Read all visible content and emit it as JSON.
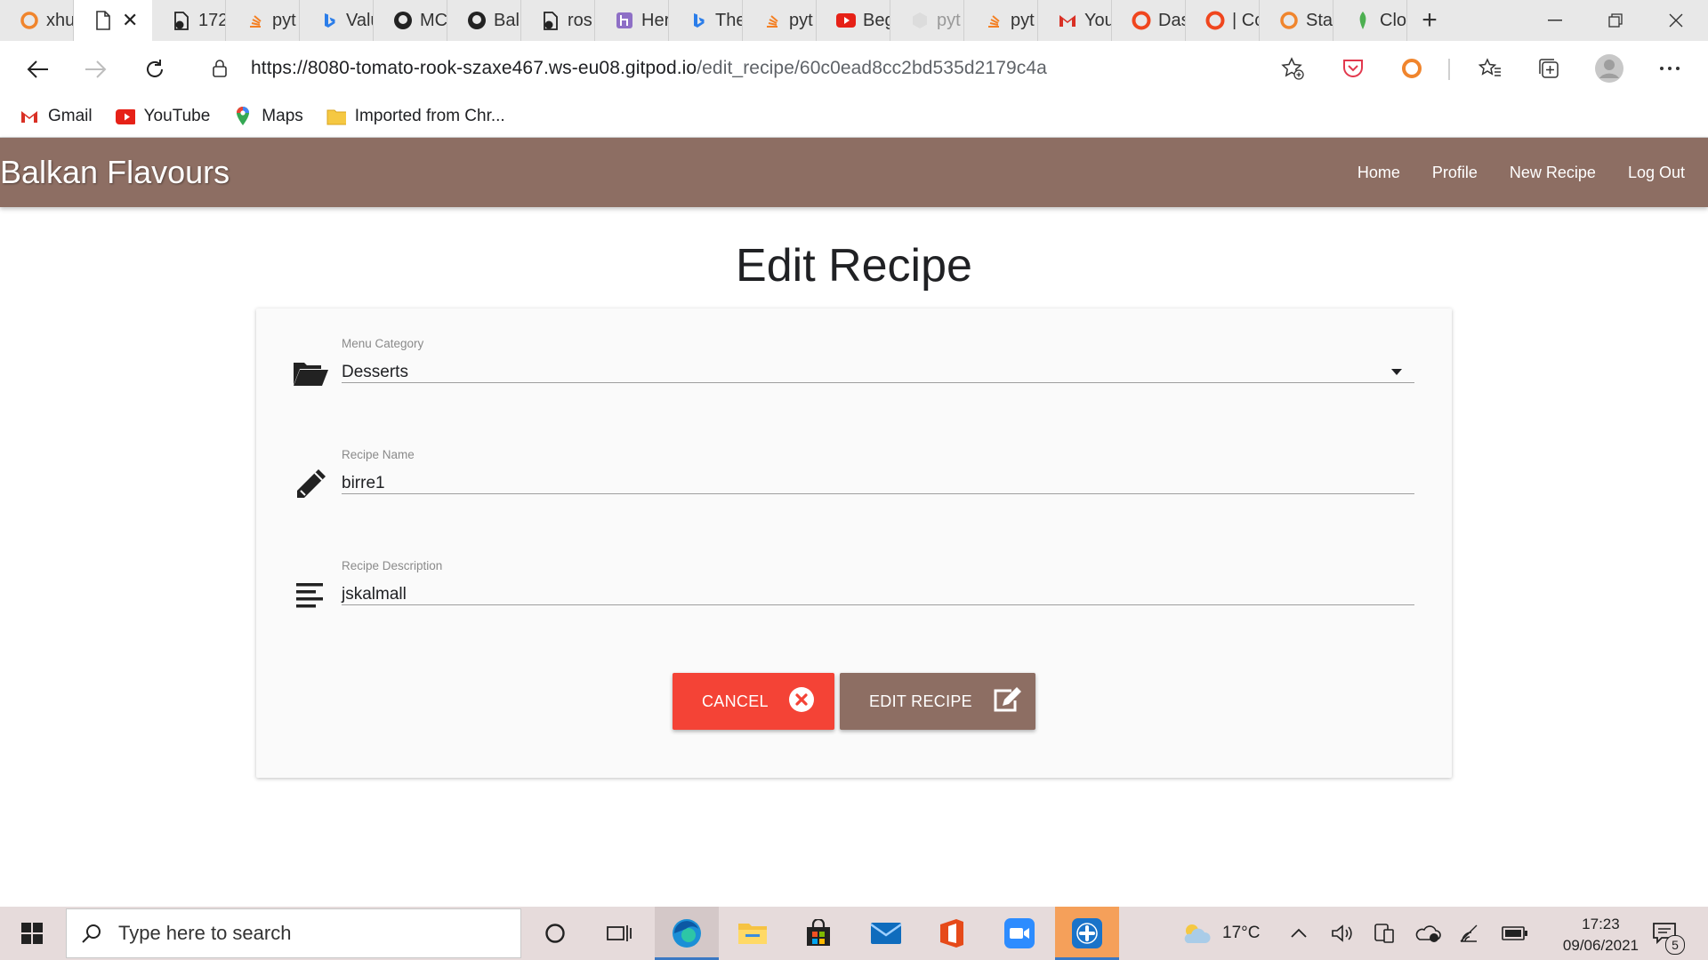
{
  "browser": {
    "tabs": [
      {
        "label": "xhu",
        "icon": "grammarly-icon"
      },
      {
        "label": "",
        "icon": "page-icon",
        "active": true
      },
      {
        "label": "172",
        "icon": "gitpod-icon"
      },
      {
        "label": "pyt",
        "icon": "stackoverflow-icon"
      },
      {
        "label": "Valu",
        "icon": "bing-icon"
      },
      {
        "label": "MC",
        "icon": "github-icon"
      },
      {
        "label": "Ball",
        "icon": "github-icon"
      },
      {
        "label": "ros",
        "icon": "gitpod-icon"
      },
      {
        "label": "Her",
        "icon": "heroku-icon"
      },
      {
        "label": "The",
        "icon": "bing-icon"
      },
      {
        "label": "pyt",
        "icon": "stackoverflow-icon"
      },
      {
        "label": "Beg",
        "icon": "youtube-icon"
      },
      {
        "label": "pyt",
        "icon": "blank-icon"
      },
      {
        "label": "pyt",
        "icon": "stackoverflow-icon"
      },
      {
        "label": "You",
        "icon": "gmail-icon"
      },
      {
        "label": "Das",
        "icon": "opera-icon"
      },
      {
        "label": "| Cc",
        "icon": "opera-icon"
      },
      {
        "label": "Sta",
        "icon": "grammarly-icon"
      },
      {
        "label": "Clo",
        "icon": "mongodb-icon"
      }
    ],
    "url_main": "https://8080-tomato-rook-szaxe467.ws-eu08.gitpod.io",
    "url_path": "/edit_recipe/60c0ead8cc2bd535d2179c4a",
    "bookmarks": [
      {
        "label": "Gmail",
        "icon": "gmail-icon"
      },
      {
        "label": "YouTube",
        "icon": "youtube-icon"
      },
      {
        "label": "Maps",
        "icon": "maps-pin-icon"
      },
      {
        "label": "Imported from Chr...",
        "icon": "folder-icon"
      }
    ]
  },
  "app": {
    "brand": "Balkan Flavours",
    "nav": [
      "Home",
      "Profile",
      "New Recipe",
      "Log Out"
    ],
    "page_title": "Edit Recipe",
    "form": {
      "category_label": "Menu Category",
      "category_value": "Desserts",
      "name_label": "Recipe Name",
      "name_value": "birre1",
      "description_label": "Recipe Description",
      "description_value": "jskalmall",
      "cancel_label": "CANCEL",
      "edit_label": "EDIT RECIPE"
    },
    "colors": {
      "navbar": "#8d6e63",
      "cancel": "#f44336",
      "edit": "#8d6e63"
    }
  },
  "taskbar": {
    "search_placeholder": "Type here to search",
    "temperature": "17°C",
    "time": "17:23",
    "date": "09/06/2021",
    "notification_count": "5"
  }
}
